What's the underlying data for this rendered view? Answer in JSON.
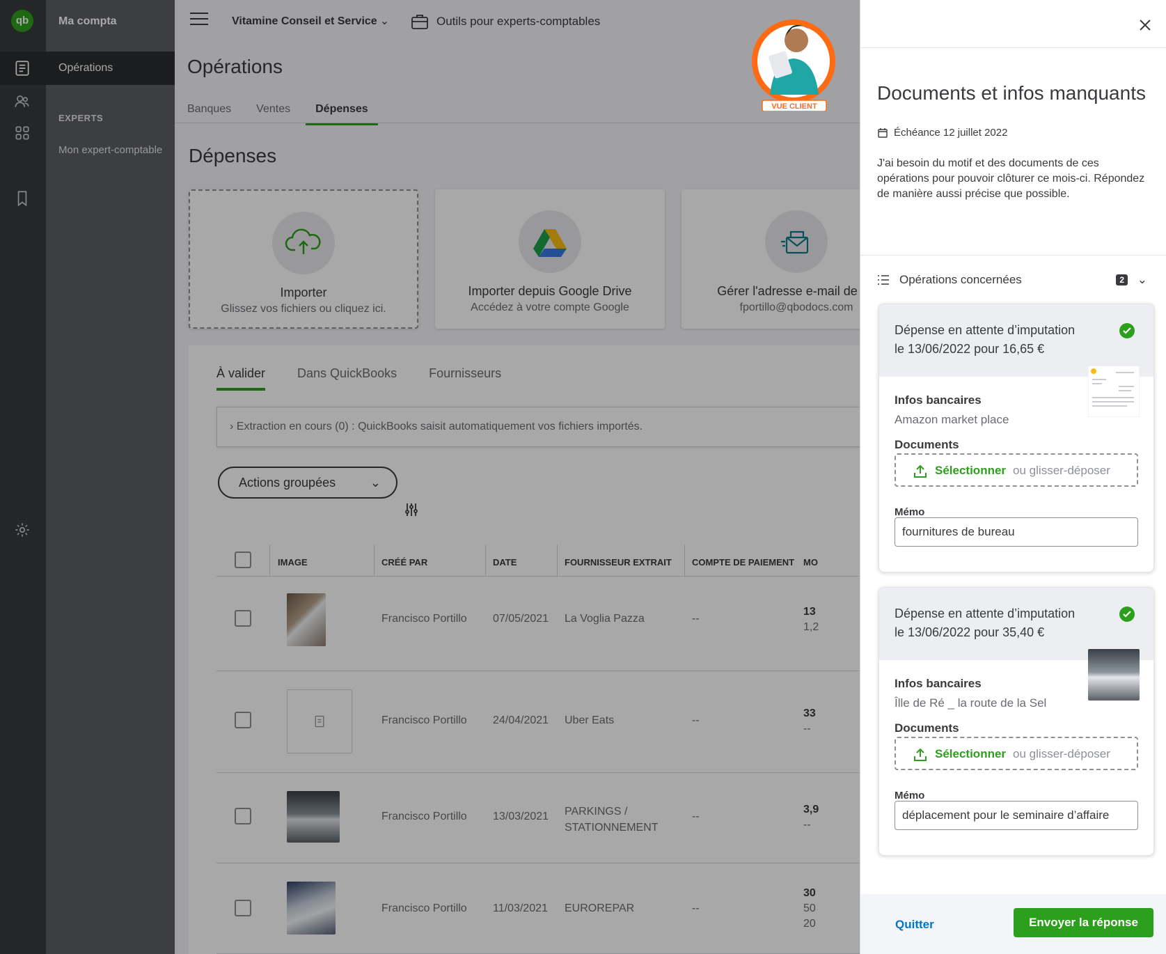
{
  "app": {
    "logo_text": "qb",
    "brand": "Ma compta",
    "nav_active": "Opérations",
    "nav_section": "EXPERTS",
    "nav_sub": "Mon expert-comptable"
  },
  "topbar": {
    "company": "Vitamine Conseil et Service",
    "tools": "Outils pour experts-comptables"
  },
  "page": {
    "title": "Opérations",
    "tabs": [
      "Banques",
      "Ventes",
      "Dépenses"
    ],
    "active_tab": "Dépenses",
    "section_title": "Dépenses"
  },
  "cards": [
    {
      "title": "Importer",
      "subtitle": "Glissez vos fichiers ou cliquez ici."
    },
    {
      "title": "Importer depuis Google Drive",
      "subtitle": "Accédez à votre compte Google"
    },
    {
      "title": "Gérer l'adresse e-mail de tra",
      "subtitle": "fportillo@qbodocs.com"
    }
  ],
  "subtabs": [
    "À valider",
    "Dans QuickBooks",
    "Fournisseurs"
  ],
  "extraction": "Extraction en cours (0) : QuickBooks saisit automatiquement vos fichiers importés.",
  "actions_label": "Actions groupées",
  "table": {
    "headers": [
      "IMAGE",
      "CRÉÉ PAR",
      "DATE",
      "FOURNISSEUR EXTRAIT",
      "COMPTE DE PAIEMENT",
      "MO"
    ],
    "rows": [
      {
        "created_by": "Francisco Portillo",
        "date": "07/05/2021",
        "supplier": "La Voglia Pazza",
        "account": "--",
        "amount": "13",
        "amount2": "1,2"
      },
      {
        "created_by": "Francisco Portillo",
        "date": "24/04/2021",
        "supplier": "Uber Eats",
        "account": "--",
        "amount": "33",
        "amount2": "--"
      },
      {
        "created_by": "Francisco Portillo",
        "date": "13/03/2021",
        "supplier": "PARKINGS / STATIONNEMENT",
        "account": "--",
        "amount": "3,9",
        "amount2": "--"
      },
      {
        "created_by": "Francisco Portillo",
        "date": "11/03/2021",
        "supplier": "EUROREPAR",
        "account": "--",
        "amount": "30",
        "amount2": "50",
        "amount3": "20"
      }
    ]
  },
  "badge_label": "VUE CLIENT",
  "drawer": {
    "title": "Documents et infos manquants",
    "due": "Échéance 12 juillet 2022",
    "description": "J'ai besoin du motif et des documents de ces opérations pour pouvoir clôturer ce mois-ci. Répondez de manière aussi précise que possible.",
    "ops_header": "Opérations concernées",
    "ops_count": "2",
    "ops": [
      {
        "line1": "Dépense en attente d’imputation",
        "line2": "le 13/06/2022 pour 16,65 €",
        "bank_label": "Infos bancaires",
        "bank_value": "Amazon market place",
        "docs_label": "Documents",
        "select": "Sélectionner",
        "or_drop": "ou glisser-déposer",
        "memo_label": "Mémo",
        "memo_value": "fournitures de bureau"
      },
      {
        "line1": "Dépense en attente d’imputation",
        "line2": "le 13/06/2022 pour 35,40 €",
        "bank_label": "Infos bancaires",
        "bank_value": "Îlle de Ré _ la route de la Sel",
        "docs_label": "Documents",
        "select": "Sélectionner",
        "or_drop": "ou glisser-déposer",
        "memo_label": "Mémo",
        "memo_value": "déplacement pour le seminaire d’affaire"
      }
    ],
    "quit": "Quitter",
    "send": "Envoyer la réponse"
  },
  "colors": {
    "accent": "#2ca01c",
    "link": "#0077c5",
    "rail": "#393a3d",
    "nav": "#5c5f63"
  }
}
